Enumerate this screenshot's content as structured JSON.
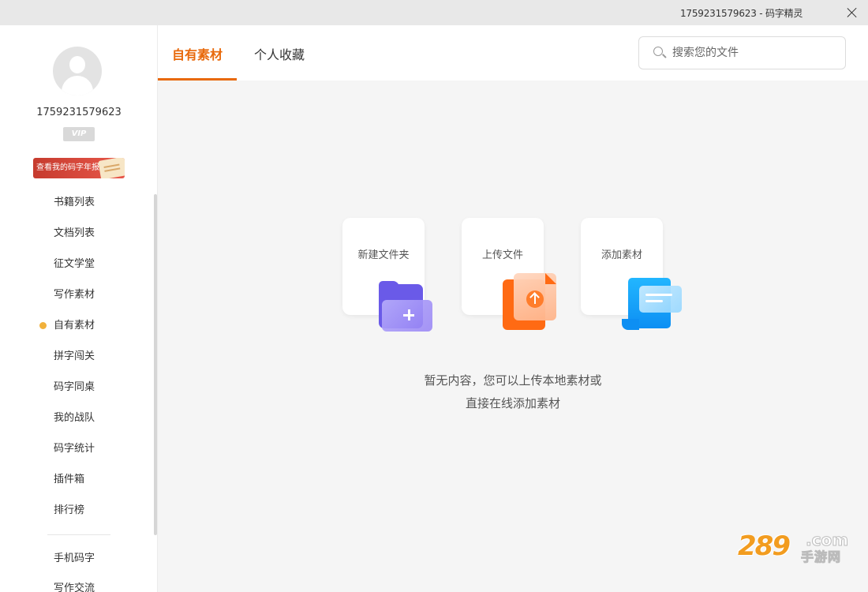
{
  "titlebar": {
    "user_id": "1759231579623 - 码字精灵"
  },
  "profile": {
    "username": "1759231579623",
    "vip_badge": "VIP",
    "annual_report_banner": "查看我的码字年报"
  },
  "sidebar": {
    "items": [
      {
        "label": "书籍列表",
        "active": false
      },
      {
        "label": "文档列表",
        "active": false
      },
      {
        "label": "征文学堂",
        "active": false
      },
      {
        "label": "写作素材",
        "active": false
      },
      {
        "label": "自有素材",
        "active": true
      },
      {
        "label": "拼字闯关",
        "active": false
      },
      {
        "label": "码字同桌",
        "active": false
      },
      {
        "label": "我的战队",
        "active": false
      },
      {
        "label": "码字统计",
        "active": false
      },
      {
        "label": "插件箱",
        "active": false
      },
      {
        "label": "排行榜",
        "active": false
      }
    ],
    "bottom_items": [
      {
        "label": "手机码字"
      },
      {
        "label": "写作交流"
      }
    ],
    "active_dot_color": "#f1b13b"
  },
  "tabs": [
    {
      "label": "自有素材",
      "active": true
    },
    {
      "label": "个人收藏",
      "active": false
    }
  ],
  "search": {
    "placeholder": "搜索您的文件",
    "value": ""
  },
  "actions": {
    "new_folder": "新建文件夹",
    "upload_file": "上传文件",
    "add_material": "添加素材"
  },
  "empty_state": {
    "line1": "暂无内容，您可以上传本地素材或",
    "line2": "直接在线添加素材"
  },
  "watermark": {
    "main": "289",
    "domain": ".com",
    "sub": "手游网"
  },
  "colors": {
    "accent": "#e8690b",
    "folder": "#6a5ae8",
    "upload": "#ff6a13",
    "add": "#0d8ff3"
  }
}
